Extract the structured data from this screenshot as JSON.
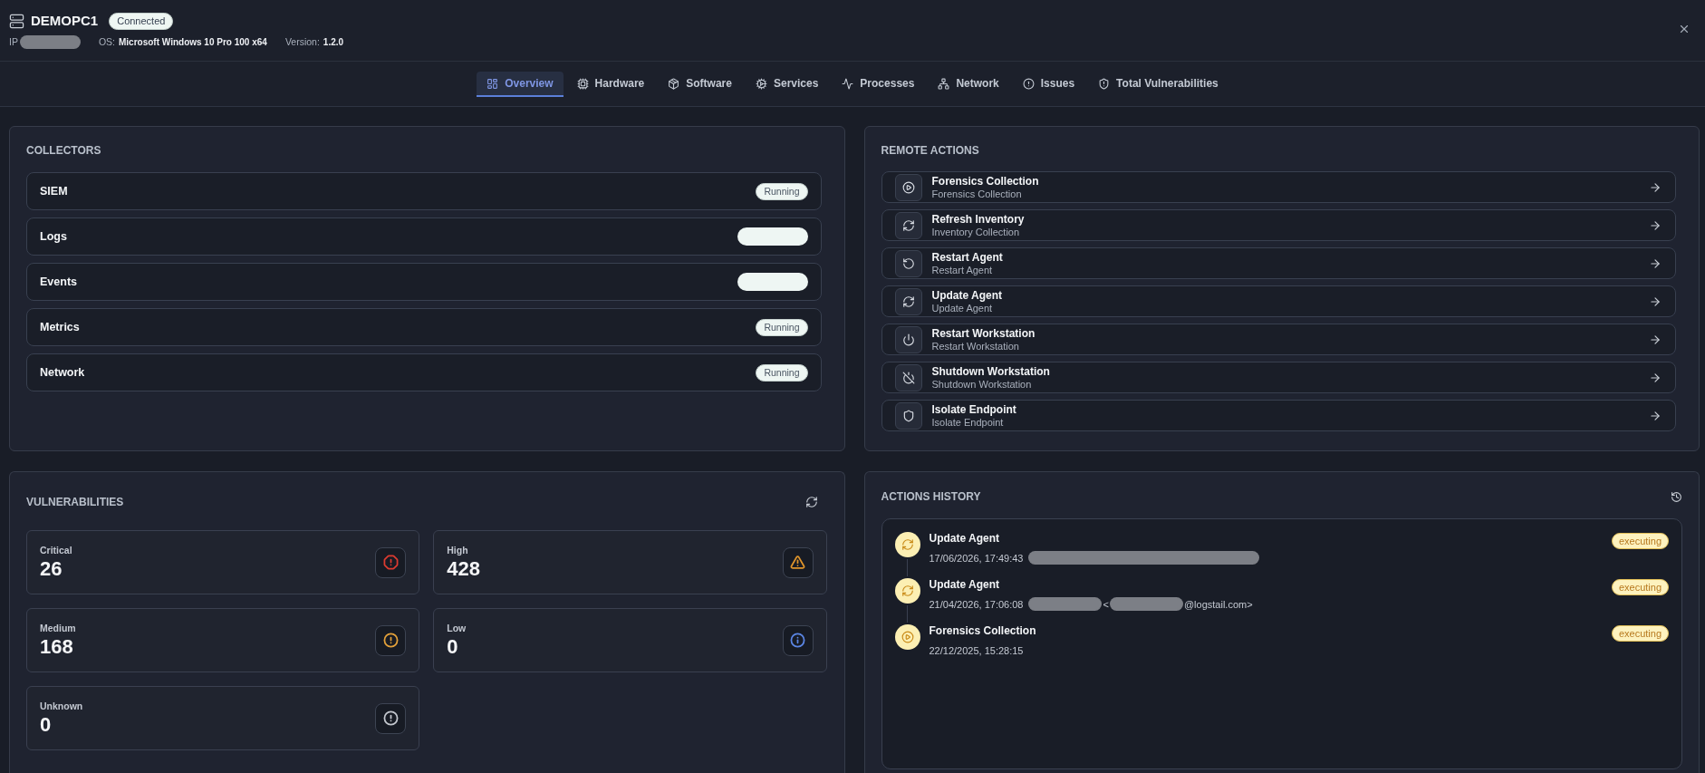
{
  "header": {
    "title": "DEMOPC1",
    "status": "Connected",
    "ip_label": "IP",
    "ip_redacted": true,
    "os_label": "OS:",
    "os": "Microsoft Windows 10 Pro 100 x64",
    "version_label": "Version:",
    "version": "1.2.0"
  },
  "tabs": [
    {
      "label": "Overview",
      "selected": true
    },
    {
      "label": "Hardware",
      "selected": false
    },
    {
      "label": "Software",
      "selected": false
    },
    {
      "label": "Services",
      "selected": false
    },
    {
      "label": "Processes",
      "selected": false
    },
    {
      "label": "Network",
      "selected": false
    },
    {
      "label": "Issues",
      "selected": false
    },
    {
      "label": "Total Vulnerabilities",
      "selected": false
    }
  ],
  "collectors": {
    "title": "COLLECTORS",
    "items": [
      {
        "name": "SIEM",
        "status": {
          "kind": "label",
          "text": "Running"
        }
      },
      {
        "name": "Logs",
        "status": {
          "kind": "redacted"
        }
      },
      {
        "name": "Events",
        "status": {
          "kind": "redacted"
        }
      },
      {
        "name": "Metrics",
        "status": {
          "kind": "label",
          "text": "Running"
        }
      },
      {
        "name": "Network",
        "status": {
          "kind": "label",
          "text": "Running"
        }
      }
    ]
  },
  "remote_actions": {
    "title": "REMOTE ACTIONS",
    "items": [
      {
        "title": "Forensics Collection",
        "subtitle": "Forensics Collection"
      },
      {
        "title": "Refresh Inventory",
        "subtitle": "Inventory Collection"
      },
      {
        "title": "Restart Agent",
        "subtitle": "Restart Agent"
      },
      {
        "title": "Update Agent",
        "subtitle": "Update Agent"
      },
      {
        "title": "Restart Workstation",
        "subtitle": "Restart Workstation"
      },
      {
        "title": "Shutdown Workstation",
        "subtitle": "Shutdown Workstation"
      },
      {
        "title": "Isolate Endpoint",
        "subtitle": "Isolate Endpoint"
      }
    ]
  },
  "vulnerabilities": {
    "title": "VULNERABILITIES",
    "cards": [
      {
        "label": "Critical",
        "count": "26",
        "color": "#dc3b30"
      },
      {
        "label": "High",
        "count": "428",
        "color": "#e0952b"
      },
      {
        "label": "Medium",
        "count": "168",
        "color": "#e3a13a"
      },
      {
        "label": "Low",
        "count": "0",
        "color": "#5b86e5"
      },
      {
        "label": "Unknown",
        "count": "0",
        "color": "#c3c7ce"
      }
    ]
  },
  "actions_history": {
    "title": "ACTIONS HISTORY",
    "items": [
      {
        "title": "Update Agent",
        "time": "17/06/2026, 17:49:43",
        "user": [
          {
            "kind": "redacted"
          }
        ],
        "status": "executing"
      },
      {
        "title": "Update Agent",
        "time": "21/04/2026, 17:06:08",
        "user": [
          {
            "kind": "redacted"
          },
          {
            "kind": "text",
            "text": "<"
          },
          {
            "kind": "redacted"
          },
          {
            "kind": "text",
            "text": "@logstail.com>"
          }
        ],
        "status": "executing"
      },
      {
        "title": "Forensics Collection",
        "time": "22/12/2025, 15:28:15",
        "status": "executing"
      }
    ]
  }
}
